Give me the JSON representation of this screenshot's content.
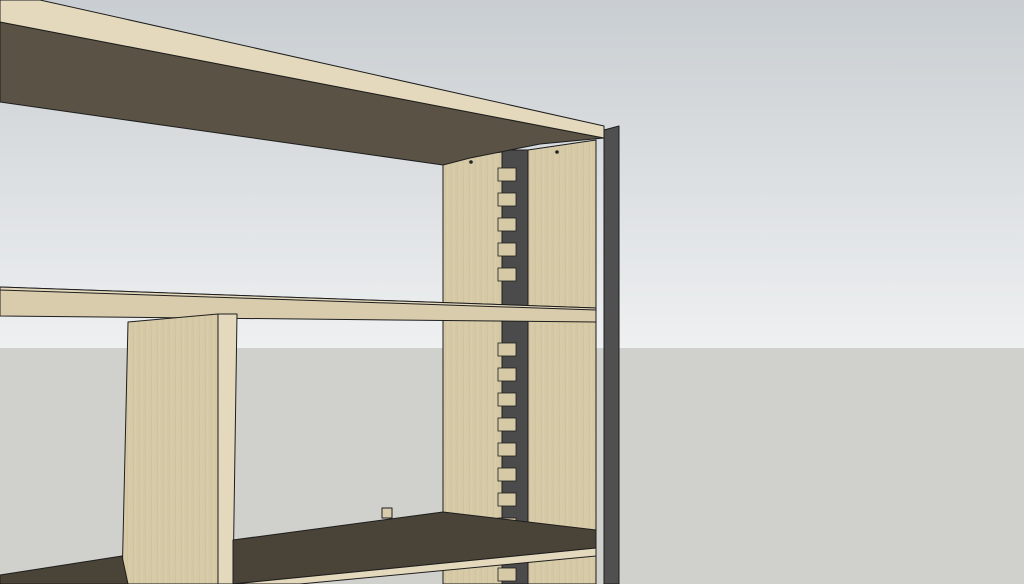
{
  "scene": {
    "kind": "3d-model-viewport",
    "subject": "bookshelf-with-dado-side-panels",
    "colors": {
      "sky_top": "#c9ced2",
      "sky_bottom": "#eef0f1",
      "ground": "#d0d0cc",
      "wood_face": "#d8ccac",
      "wood_panel": "#d6c9a6",
      "wood_shadow": "#5a5244",
      "wood_dark": "#4a4438",
      "wood_edge": "#e4d9bc",
      "dado_strip": "#4b4b4b",
      "end_panel": "#505050",
      "edge_line": "#1e1e1e"
    }
  }
}
